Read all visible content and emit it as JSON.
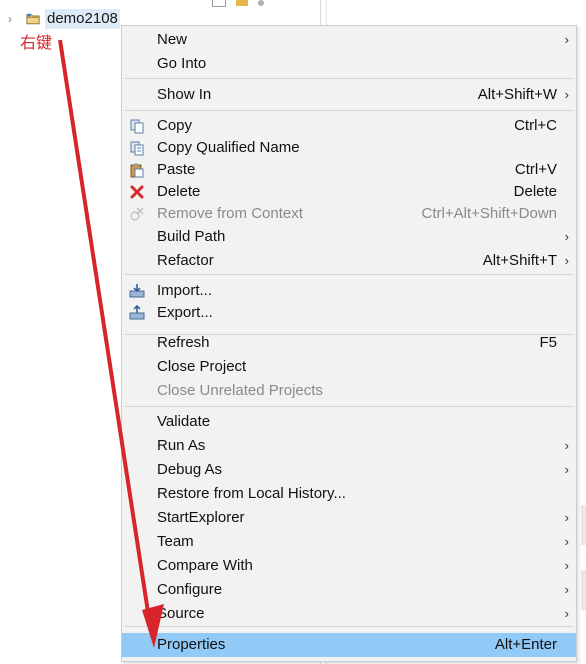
{
  "explorer": {
    "project_name": "demo2108",
    "annotation": "右键"
  },
  "menu": {
    "items": [
      {
        "label": "New",
        "shortcut": "",
        "submenu": true,
        "disabled": false,
        "icon": ""
      },
      {
        "label": "Go Into",
        "shortcut": "",
        "submenu": false,
        "disabled": false,
        "icon": ""
      },
      {
        "label": "Show In",
        "shortcut": "Alt+Shift+W",
        "submenu": true,
        "disabled": false,
        "icon": ""
      },
      {
        "label": "Copy",
        "shortcut": "Ctrl+C",
        "submenu": false,
        "disabled": false,
        "icon": "copy-icon"
      },
      {
        "label": "Copy Qualified Name",
        "shortcut": "",
        "submenu": false,
        "disabled": false,
        "icon": "copy-qualified-name-icon"
      },
      {
        "label": "Paste",
        "shortcut": "Ctrl+V",
        "submenu": false,
        "disabled": false,
        "icon": "paste-icon"
      },
      {
        "label": "Delete",
        "shortcut": "Delete",
        "submenu": false,
        "disabled": false,
        "icon": "delete-icon"
      },
      {
        "label": "Remove from Context",
        "shortcut": "Ctrl+Alt+Shift+Down",
        "submenu": false,
        "disabled": true,
        "icon": "remove-from-context-icon"
      },
      {
        "label": "Build Path",
        "shortcut": "",
        "submenu": true,
        "disabled": false,
        "icon": ""
      },
      {
        "label": "Refactor",
        "shortcut": "Alt+Shift+T",
        "submenu": true,
        "disabled": false,
        "icon": ""
      },
      {
        "label": "Import...",
        "shortcut": "",
        "submenu": false,
        "disabled": false,
        "icon": "import-icon"
      },
      {
        "label": "Export...",
        "shortcut": "",
        "submenu": false,
        "disabled": false,
        "icon": "export-icon"
      },
      {
        "label": "Refresh",
        "shortcut": "F5",
        "submenu": false,
        "disabled": false,
        "icon": ""
      },
      {
        "label": "Close Project",
        "shortcut": "",
        "submenu": false,
        "disabled": false,
        "icon": ""
      },
      {
        "label": "Close Unrelated Projects",
        "shortcut": "",
        "submenu": false,
        "disabled": true,
        "icon": ""
      },
      {
        "label": "Validate",
        "shortcut": "",
        "submenu": false,
        "disabled": false,
        "icon": ""
      },
      {
        "label": "Run As",
        "shortcut": "",
        "submenu": true,
        "disabled": false,
        "icon": ""
      },
      {
        "label": "Debug As",
        "shortcut": "",
        "submenu": true,
        "disabled": false,
        "icon": ""
      },
      {
        "label": "Restore from Local History...",
        "shortcut": "",
        "submenu": false,
        "disabled": false,
        "icon": ""
      },
      {
        "label": "StartExplorer",
        "shortcut": "",
        "submenu": true,
        "disabled": false,
        "icon": ""
      },
      {
        "label": "Team",
        "shortcut": "",
        "submenu": true,
        "disabled": false,
        "icon": ""
      },
      {
        "label": "Compare With",
        "shortcut": "",
        "submenu": true,
        "disabled": false,
        "icon": ""
      },
      {
        "label": "Configure",
        "shortcut": "",
        "submenu": true,
        "disabled": false,
        "icon": ""
      },
      {
        "label": "Source",
        "shortcut": "",
        "submenu": true,
        "disabled": false,
        "icon": ""
      },
      {
        "label": "Properties",
        "shortcut": "Alt+Enter",
        "submenu": false,
        "disabled": false,
        "icon": "",
        "highlighted": true
      }
    ],
    "submenu_glyph": "›"
  },
  "colors": {
    "menu_background": "#f2f2f2",
    "highlight": "#91c9f7",
    "annotation_red": "#d6262c",
    "disabled_text": "#8a8a8a"
  }
}
